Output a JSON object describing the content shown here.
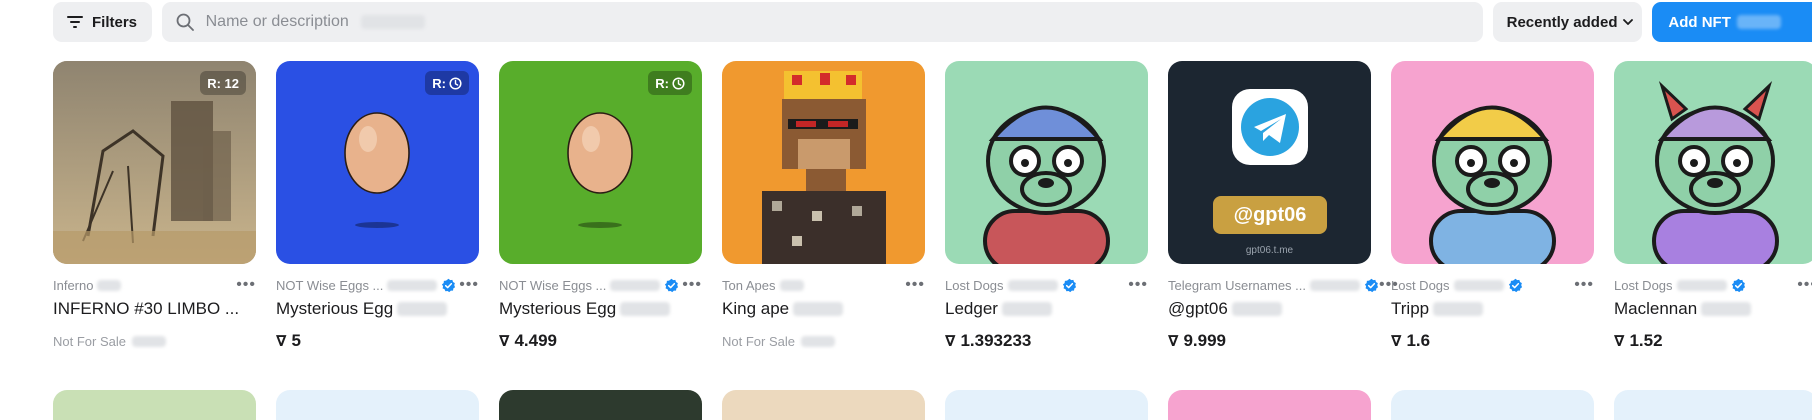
{
  "toolbar": {
    "filters_label": "Filters",
    "search_placeholder": "Name or description",
    "sort_label": "Recently added",
    "add_label": "Add NFT"
  },
  "cards": [
    {
      "collection": "Inferno",
      "name": "INFERNO #30 LIMBO ...",
      "badge": "R: 12",
      "status": "Not For Sale",
      "bg": "#a99b80"
    },
    {
      "collection": "NOT Wise Eggs ...",
      "name": "Mysterious Egg",
      "badge": "R:",
      "price": "5",
      "bg": "#2a50e4",
      "verified": true
    },
    {
      "collection": "NOT Wise Eggs ...",
      "name": "Mysterious Egg",
      "badge": "R:",
      "price": "4.499",
      "bg": "#58ad2b",
      "verified": true
    },
    {
      "collection": "Ton Apes",
      "name": "King ape",
      "status": "Not For Sale",
      "bg": "#f0992f"
    },
    {
      "collection": "Lost Dogs",
      "name": "Ledger",
      "price": "1.393233",
      "bg": "#9bdab5",
      "verified": true
    },
    {
      "collection": "Telegram Usernames ...",
      "name": "@gpt06",
      "price": "9.999",
      "bg": "#1c2631",
      "verified": true,
      "tag": "@gpt06",
      "tag_sub": "gpt06.t.me"
    },
    {
      "collection": "Lost Dogs",
      "name": "Tripp",
      "price": "1.6",
      "bg": "#f6a3cf",
      "verified": true
    },
    {
      "collection": "Lost Dogs",
      "name": "Maclennan",
      "price": "1.52",
      "bg": "#9bdab5",
      "verified": true
    }
  ],
  "row2_colors": [
    "#c9e0b5",
    "#e4f1fb",
    "#2d3a2e",
    "#ecd9be",
    "#e4f1fb",
    "#f6a3cf",
    "#e4f1fb",
    "#e4f1fb"
  ],
  "currency_symbol": "∇",
  "more_symbol": "•••"
}
